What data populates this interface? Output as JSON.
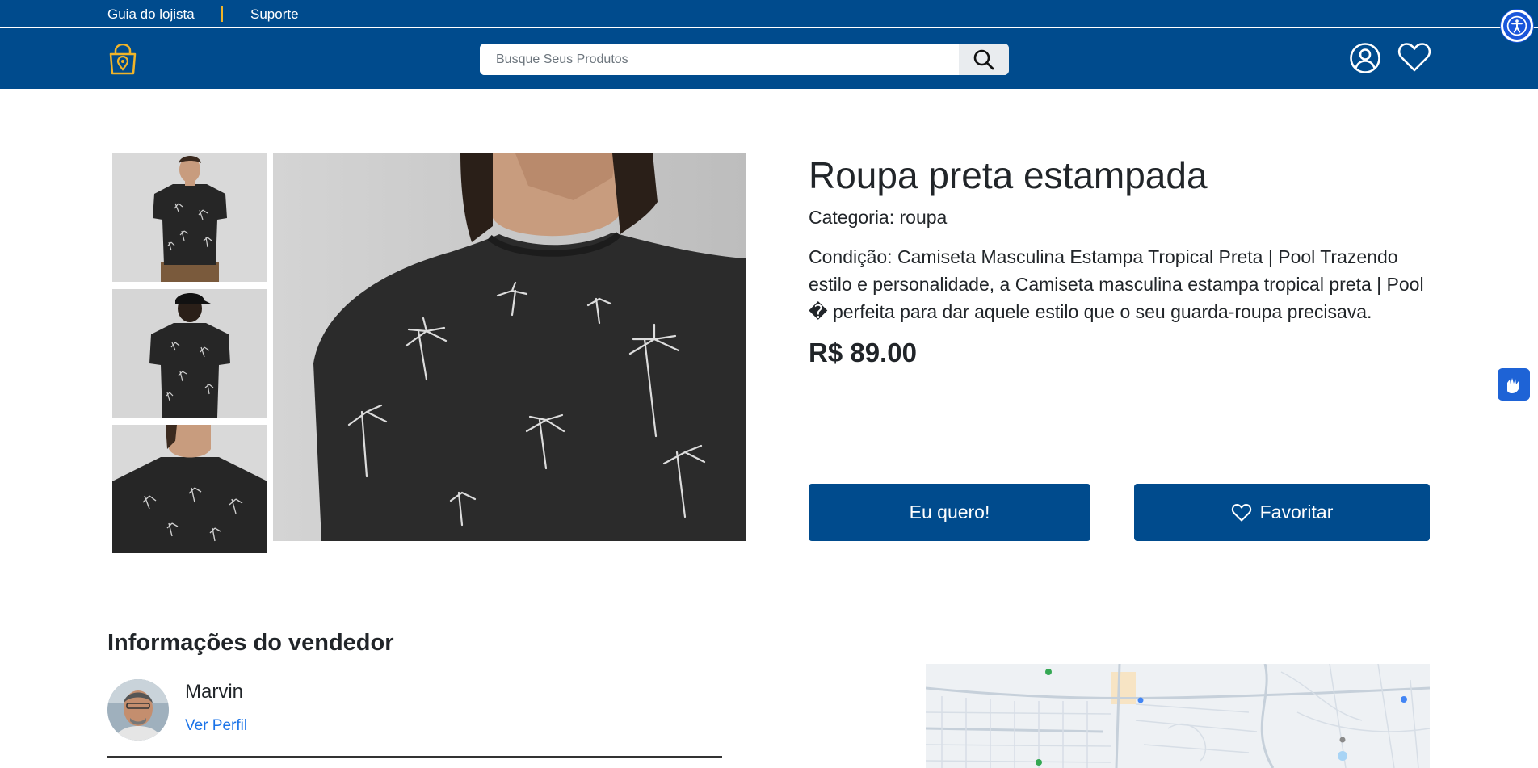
{
  "topbar": {
    "guide_label": "Guia do lojista",
    "support_label": "Suporte"
  },
  "header": {
    "search_placeholder": "Busque Seus Produtos",
    "search_icon": "search-icon",
    "user_icon": "user-circle-icon",
    "favorites_icon": "heart-icon",
    "logo_icon": "shopping-bag-location-icon"
  },
  "product": {
    "title": "Roupa preta estampada",
    "category": "Categoria: roupa",
    "description": "Condição: Camiseta Masculina Estampa Tropical Preta | Pool Trazendo estilo e personalidade, a Camiseta masculina estampa tropical preta | Pool � perfeita para dar aquele estilo que o seu guarda-roupa precisava.",
    "price": "R$ 89.00",
    "want_label": "Eu quero!",
    "favorite_label": "Favoritar"
  },
  "seller": {
    "heading": "Informações do vendedor",
    "name": "Marvin",
    "profile_link": "Ver Perfil"
  },
  "colors": {
    "brand_blue": "#004b8d",
    "accent_gold": "#f0b429",
    "link_blue": "#1a73e8"
  }
}
